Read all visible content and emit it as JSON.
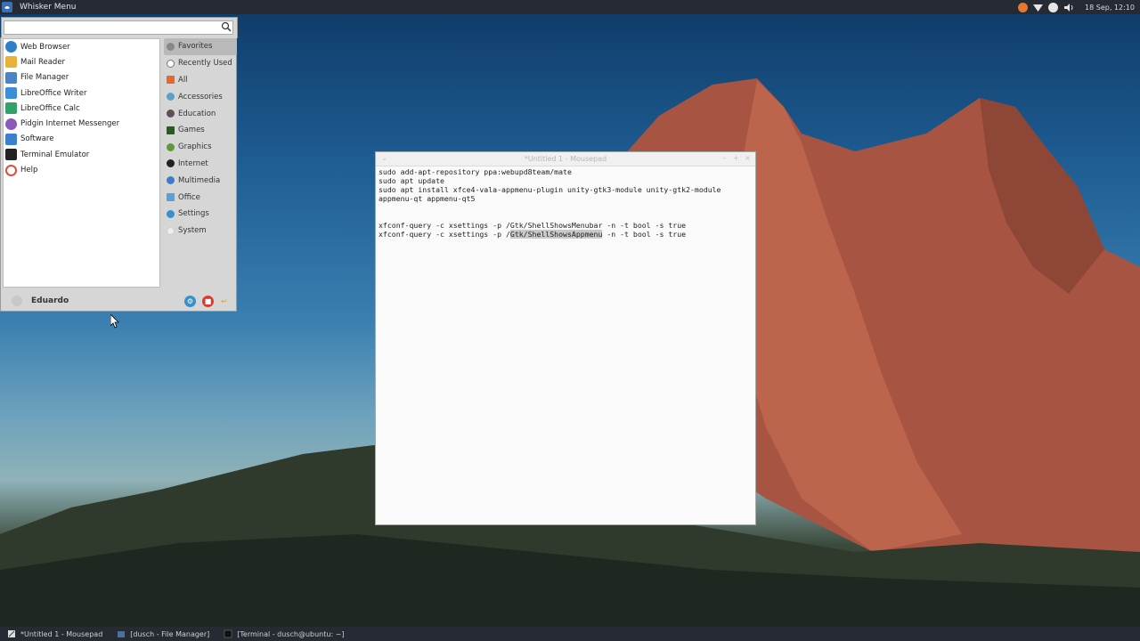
{
  "top_panel": {
    "menu_label": "Whisker Menu",
    "clock": "18 Sep, 12:10"
  },
  "whisker_menu": {
    "search": {
      "placeholder": "",
      "value": ""
    },
    "favorites": [
      {
        "label": "Web Browser",
        "icon": "globe-icon",
        "color": "#2f7fc8"
      },
      {
        "label": "Mail Reader",
        "icon": "mail-icon",
        "color": "#e8b23a"
      },
      {
        "label": "File Manager",
        "icon": "folder-icon",
        "color": "#4a84c4"
      },
      {
        "label": "LibreOffice Writer",
        "icon": "writer-icon",
        "color": "#3a8fd8"
      },
      {
        "label": "LibreOffice Calc",
        "icon": "calc-icon",
        "color": "#34a06a"
      },
      {
        "label": "Pidgin Internet Messenger",
        "icon": "pidgin-icon",
        "color": "#8a5ab8"
      },
      {
        "label": "Software",
        "icon": "software-icon",
        "color": "#3d7ed0"
      },
      {
        "label": "Terminal Emulator",
        "icon": "terminal-icon",
        "color": "#222222"
      },
      {
        "label": "Help",
        "icon": "help-icon",
        "color": "#e24c3c"
      }
    ],
    "categories": [
      {
        "label": "Favorites",
        "icon": "star-icon",
        "color": "#888888",
        "active": true
      },
      {
        "label": "Recently Used",
        "icon": "clock-icon",
        "color": "#777777"
      },
      {
        "label": "All",
        "icon": "all-icon",
        "color": "#e06b2c"
      },
      {
        "label": "Accessories",
        "icon": "accessories-icon",
        "color": "#5aa0c8"
      },
      {
        "label": "Education",
        "icon": "education-icon",
        "color": "#555555"
      },
      {
        "label": "Games",
        "icon": "games-icon",
        "color": "#2a5a22"
      },
      {
        "label": "Graphics",
        "icon": "graphics-icon",
        "color": "#5a9a3a"
      },
      {
        "label": "Internet",
        "icon": "internet-icon",
        "color": "#222222"
      },
      {
        "label": "Multimedia",
        "icon": "multimedia-icon",
        "color": "#3a7ec8"
      },
      {
        "label": "Office",
        "icon": "office-icon",
        "color": "#5aa0d8"
      },
      {
        "label": "Settings",
        "icon": "settings-icon",
        "color": "#3a90c8"
      },
      {
        "label": "System",
        "icon": "system-icon",
        "color": "#dddddd"
      }
    ],
    "user_name": "Eduardo"
  },
  "editor": {
    "title": "*Untitled 1 - Mousepad",
    "lines": [
      "sudo add-apt-repository ppa:webupd8team/mate",
      "sudo apt update",
      "sudo apt install xfce4-vala-appmenu-plugin unity-gtk3-module unity-gtk2-module",
      "appmenu-qt appmenu-qt5",
      "",
      "",
      "xfconf-query -c xsettings -p /Gtk/ShellShowsMenubar -n -t bool -s true"
    ],
    "last_line_prefix": "xfconf-query -c xsettings -p /",
    "last_line_selected": "Gtk/ShellShowsAppmenu",
    "last_line_suffix": " -n -t bool -s true"
  },
  "taskbar": {
    "tasks": [
      {
        "label": "*Untitled 1 - Mousepad"
      },
      {
        "label": "[dusch - File Manager]"
      },
      {
        "label": "[Terminal - dusch@ubuntu: ~]"
      }
    ]
  }
}
